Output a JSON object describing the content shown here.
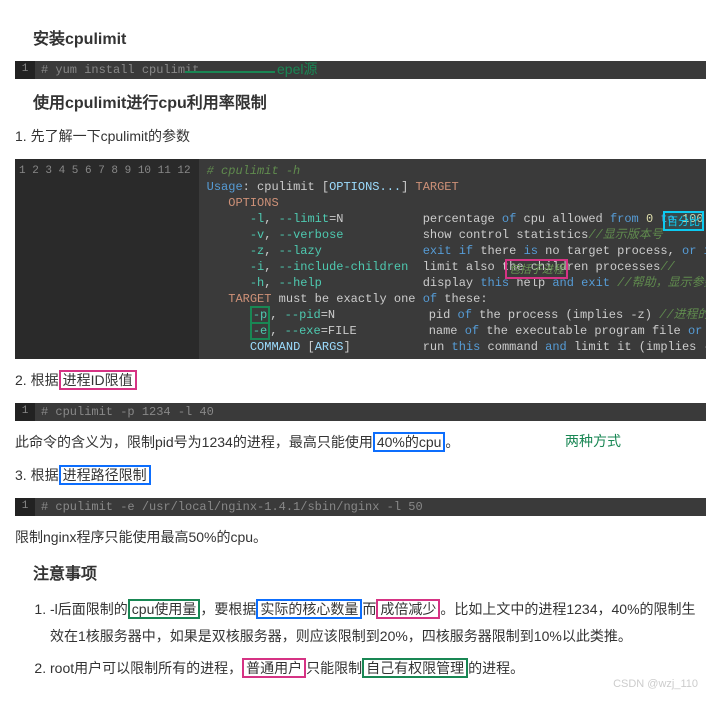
{
  "h1": "安装cpulimit",
  "cmd1": "# yum install cpulimit",
  "anno_epel": "epel源",
  "h2": "使用cpulimit进行cpu利用率限制",
  "p1": "1. 先了解一下cpulimit的参数",
  "helpblock": {
    "lines": [
      "1",
      "2",
      "3",
      "4",
      "5",
      "6",
      "7",
      "8",
      "9",
      "10",
      "11",
      "12"
    ]
  },
  "anno_percent_box": "百分比",
  "anno_include_box": "包括子进程",
  "p2_prefix": "2. 根据",
  "p2_box": "进程ID限值",
  "cmd2": "# cpulimit -p 1234 -l 40",
  "p3_a": "此命令的含义为，限制pid号为1234的进程，最高只能使用",
  "p3_box": "40%的cpu",
  "p3_b": "。",
  "anno_two_ways": "两种方式",
  "p4_prefix": "3. 根据",
  "p4_box": "进程路径限制",
  "cmd3": "# cpulimit -e /usr/local/nginx-1.4.1/sbin/nginx -l 50",
  "p5": "限制nginx程序只能使用最高50%的cpu。",
  "h3": "注意事项",
  "li1_a": "-l后面限制的",
  "li1_box1": "cpu使用量",
  "li1_b": "，要根据",
  "li1_box2": "实际的核心数量",
  "li1_c": "而",
  "li1_box3": "成倍减少",
  "li1_d": "。比如上文中的进程1234，40%的限制生效在1核服务器中，如果是双核服务器，则应该限制到20%，四核服务器限制到10%以此类推。",
  "li2_a": "root用户可以限制所有的进程，",
  "li2_box1": "普通用户",
  "li2_b": "只能限制",
  "li2_box2": "自己有权限管理",
  "li2_c": "的进程。",
  "watermark": "CSDN @wzj_110"
}
